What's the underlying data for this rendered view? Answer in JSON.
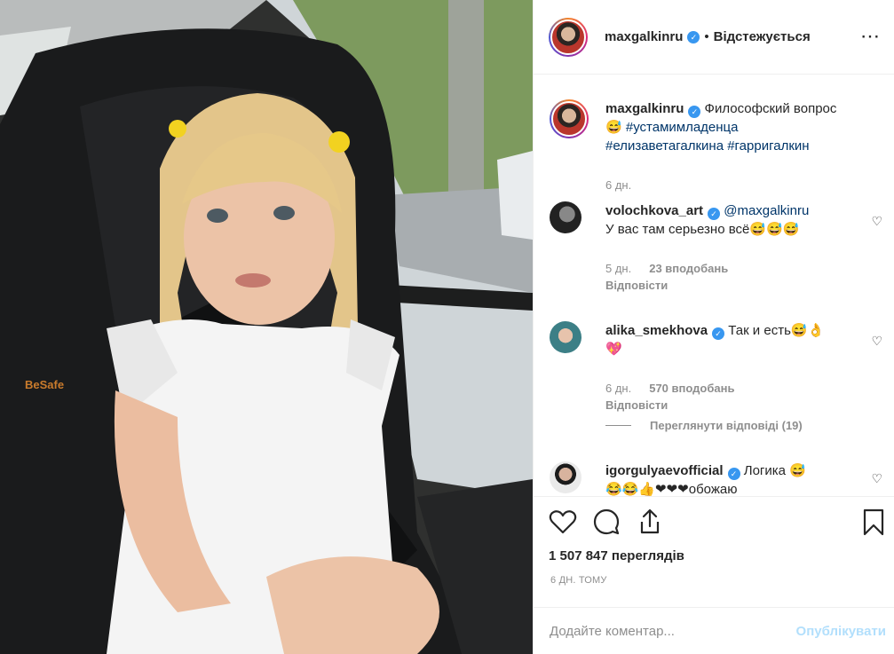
{
  "post": {
    "author": "maxgalkinru",
    "separator": "•",
    "follow_state": "Відстежується",
    "more_icon": "more-options-icon"
  },
  "caption": {
    "author": "maxgalkinru",
    "text": "Философский вопрос 😅",
    "hashtag1": "#устамимладенца",
    "hashtag2": "#елизаветагалкина",
    "hashtag3": "#гарригалкин",
    "age": "6 дн."
  },
  "comments": [
    {
      "author": "volochkova_art",
      "mention": "@maxgalkinru",
      "text": "У вас там серьезно всё😅😅😅",
      "age": "5 дн.",
      "likes": "23 вподобань",
      "reply": "Відповісти"
    },
    {
      "author": "alika_smekhova",
      "text": "Так и есть😅👌",
      "text2": "💖",
      "age": "6 дн.",
      "likes": "570 вподобань",
      "reply": "Відповісти"
    },
    {
      "author": "igorgulyaevofficial",
      "text": "Логика 😅",
      "text2": "😂😂👍❤❤❤обожаю"
    }
  ],
  "view_replies": "Переглянути відповіді (19)",
  "stats": {
    "views": "1 507 847 переглядів",
    "time": "6 ДН. ТОМУ"
  },
  "add_comment": {
    "placeholder": "Додайте коментар...",
    "publish_label": "Опублікувати"
  },
  "colors": {
    "link": "#003569",
    "verified": "#3897f0",
    "muted": "#8e8e8e",
    "publish_disabled": "#b2dffc"
  }
}
